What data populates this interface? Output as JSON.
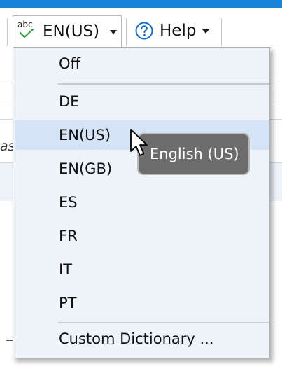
{
  "toolbar": {
    "spelling_language": {
      "icon_text": "abc",
      "label": "EN(US)"
    },
    "help": {
      "label": "Help"
    }
  },
  "background": {
    "cell_fragment": "as"
  },
  "language_menu": {
    "items": [
      {
        "label": "Off",
        "highlighted": false
      },
      {
        "label": "DE",
        "highlighted": false
      },
      {
        "label": "EN(US)",
        "highlighted": true
      },
      {
        "label": "EN(GB)",
        "highlighted": false
      },
      {
        "label": "ES",
        "highlighted": false
      },
      {
        "label": "FR",
        "highlighted": false
      },
      {
        "label": "IT",
        "highlighted": false
      },
      {
        "label": "PT",
        "highlighted": false
      },
      {
        "label": "Custom Dictionary ...",
        "highlighted": false
      }
    ]
  },
  "tooltip": {
    "text": "English (US)"
  },
  "colors": {
    "accent": "#1683d8",
    "menu_background": "#eef3fa",
    "menu_highlight": "#d4e3f6",
    "tooltip_background": "#6c6c6c"
  }
}
